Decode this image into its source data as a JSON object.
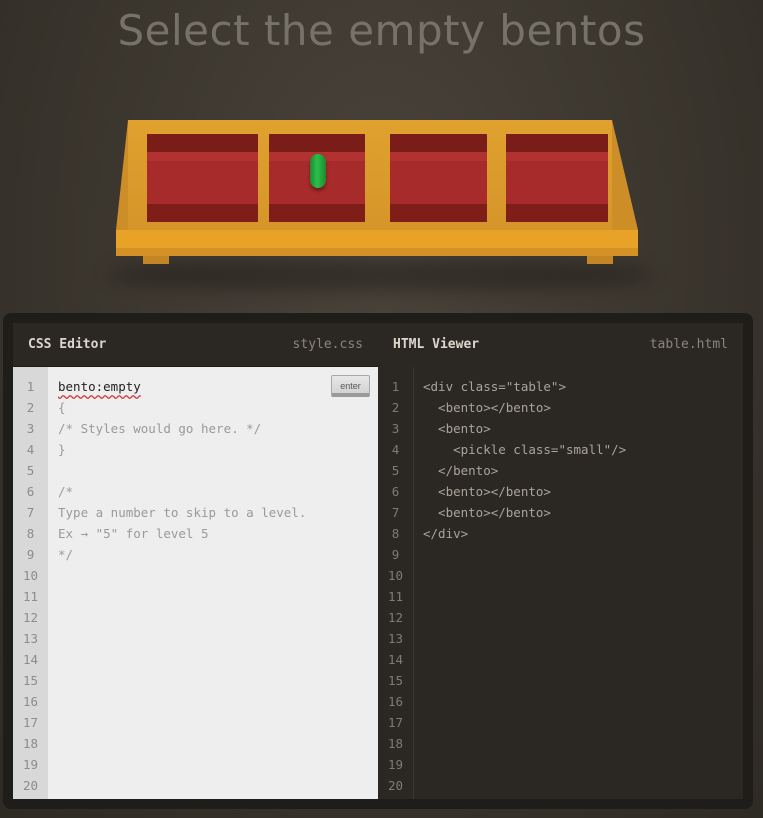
{
  "instruction": "Select the empty bentos",
  "css_editor": {
    "title": "CSS Editor",
    "filename": "style.css",
    "input_value": "bento:empty",
    "enter_label": "enter",
    "lines": [
      "{",
      "/* Styles would go here. */",
      "}",
      "",
      "/*",
      "Type a number to skip to a level.",
      "Ex → \"5\" for level 5",
      "*/"
    ],
    "line_numbers": [
      "1",
      "2",
      "3",
      "4",
      "5",
      "6",
      "7",
      "8",
      "9",
      "10",
      "11",
      "12",
      "13",
      "14",
      "15",
      "16",
      "17",
      "18",
      "19",
      "20"
    ]
  },
  "html_viewer": {
    "title": "HTML Viewer",
    "filename": "table.html",
    "lines": [
      "<div class=\"table\">",
      "  <bento></bento>",
      "  <bento>",
      "    <pickle class=\"small\"/>",
      "  </bento>",
      "  <bento></bento>",
      "  <bento></bento>",
      "</div>"
    ],
    "line_numbers": [
      "1",
      "2",
      "3",
      "4",
      "5",
      "6",
      "7",
      "8",
      "9",
      "10",
      "11",
      "12",
      "13",
      "14",
      "15",
      "16",
      "17",
      "18",
      "19",
      "20"
    ]
  },
  "colors": {
    "table": "#e0a12e",
    "bento": "#a72b2b",
    "pickle": "#2dbf4a"
  }
}
